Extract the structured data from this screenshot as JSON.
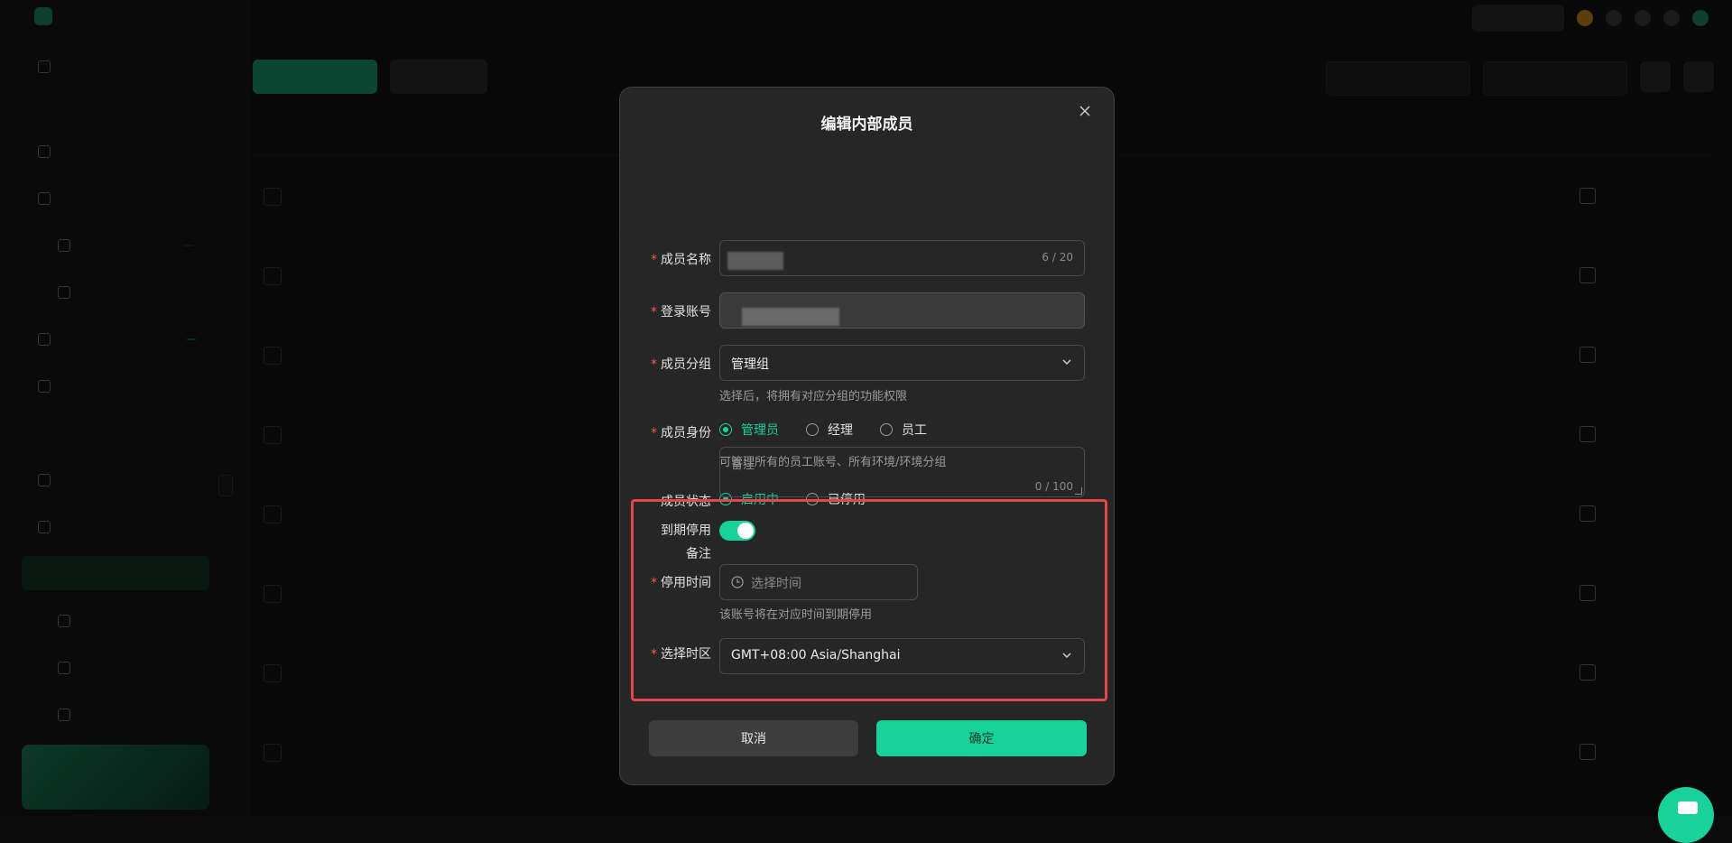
{
  "modal": {
    "title": "编辑内部成员",
    "fields": {
      "member_name": {
        "label": "成员名称",
        "counter": "6 / 20"
      },
      "login_account": {
        "label": "登录账号"
      },
      "member_group": {
        "label": "成员分组",
        "value": "管理组",
        "hint": "选择后，将拥有对应分组的功能权限"
      },
      "member_role": {
        "label": "成员身份",
        "options": [
          "管理员",
          "经理",
          "员工"
        ],
        "selected": "管理员",
        "hint": "可管理所有的员工账号、所有环境/环境分组"
      },
      "member_status": {
        "label": "成员状态",
        "options": [
          "启用中",
          "已停用"
        ],
        "selected": "启用中"
      },
      "remark": {
        "label": "备注",
        "placeholder": "备注",
        "counter": "0 / 100"
      },
      "expire_disable": {
        "label": "到期停用",
        "enabled": true
      },
      "disable_time": {
        "label": "停用时间",
        "placeholder": "选择时间",
        "hint": "该账号将在对应时间到期停用"
      },
      "timezone": {
        "label": "选择时区",
        "value": "GMT+08:00 Asia/Shanghai"
      }
    },
    "buttons": {
      "cancel": "取消",
      "confirm": "确定"
    }
  },
  "colors": {
    "accent": "#19d19a",
    "required": "#f35a5a",
    "highlight": "#e0484c",
    "modal_bg": "#262626",
    "backdrop": "#0b0b0b"
  },
  "icons": [
    "close-icon",
    "chevron-down-icon",
    "clock-icon",
    "chat-icon"
  ]
}
